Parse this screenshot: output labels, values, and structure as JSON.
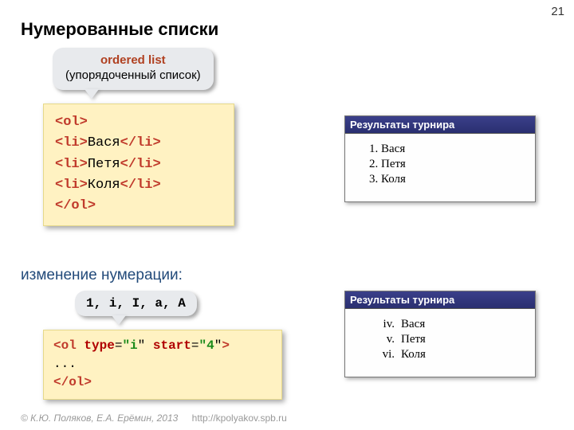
{
  "page_number": "21",
  "slide_title": "Нумерованные списки",
  "callout_top": {
    "line1": "ordered list",
    "line2": "(упорядоченный список)"
  },
  "code1": {
    "l1a": "<",
    "l1b": "ol",
    "l1c": ">",
    "l2a": "<",
    "l2b": "li",
    "l2c": ">",
    "l2d": "Вася",
    "l2e": "</",
    "l2f": "li",
    "l2g": ">",
    "l3a": "<",
    "l3b": "li",
    "l3c": ">",
    "l3d": "Петя",
    "l3e": "</",
    "l3f": "li",
    "l3g": ">",
    "l4a": "<",
    "l4b": "li",
    "l4c": ">",
    "l4d": "Коля",
    "l4e": "</",
    "l4f": "li",
    "l4g": ">",
    "l5a": "</",
    "l5b": "ol",
    "l5c": ">"
  },
  "subheading": "изменение нумерации:",
  "callout_mid": "1, i, I, a, A",
  "code2": {
    "l1a": "<",
    "l1b": "ol",
    "l1c": " ",
    "attr1": "type",
    "eq1": "=",
    "q1a": "\"",
    "val1": "i",
    "q1b": "\" ",
    "attr2": "start",
    "eq2": "=",
    "q2a": "\"",
    "val2": "4",
    "q2b": "\"",
    "l1end": ">",
    "l2": "...",
    "l3a": "</",
    "l3b": "ol",
    "l3c": ">"
  },
  "window1": {
    "title": "Результаты турнира",
    "items": [
      "Вася",
      "Петя",
      "Коля"
    ]
  },
  "window2": {
    "title": "Результаты турнира",
    "rows": [
      {
        "num": "iv.",
        "name": "Вася"
      },
      {
        "num": "v.",
        "name": "Петя"
      },
      {
        "num": "vi.",
        "name": "Коля"
      }
    ]
  },
  "footer": {
    "copyright": "© К.Ю. Поляков, Е.А. Ерёмин, 2013",
    "url": "http://kpolyakov.spb.ru"
  }
}
